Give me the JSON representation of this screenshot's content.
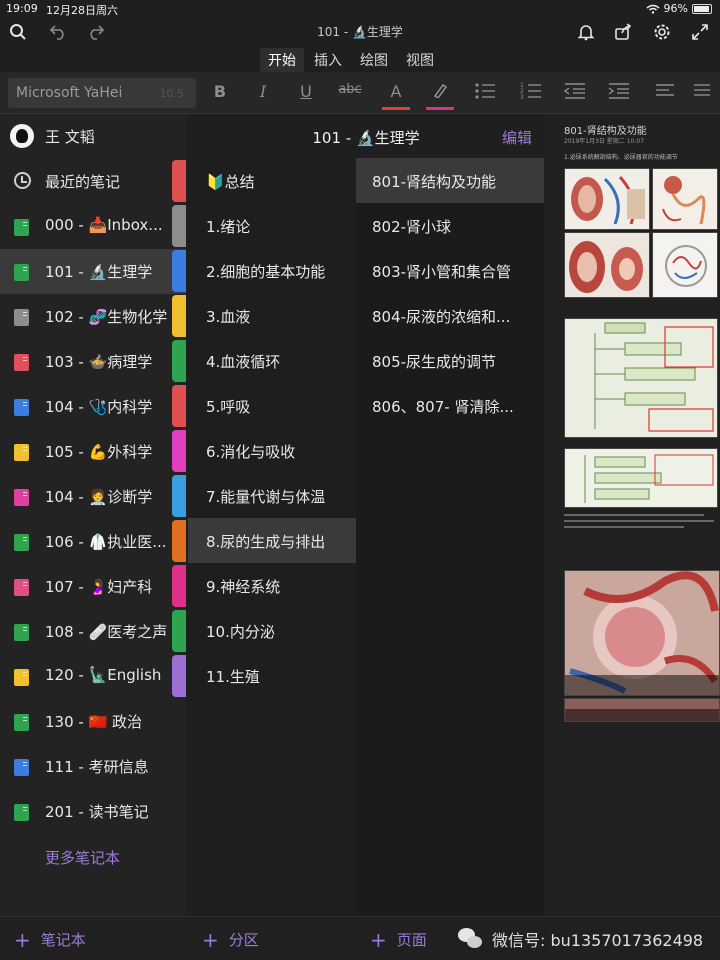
{
  "status": {
    "time": "19:09",
    "date": "12月28日周六",
    "battery": "96%"
  },
  "topbar": {
    "doc_title": "101 - 🔬生理学"
  },
  "ribbon": {
    "tabs": [
      "开始",
      "插入",
      "绘图",
      "视图"
    ],
    "active": "开始"
  },
  "format": {
    "font_name": "Microsoft YaHei",
    "font_size": "10.5",
    "bold": "B",
    "italic": "I",
    "underline": "U",
    "strike": "abc",
    "font_color": "A",
    "font_color_hex": "#e0403a",
    "highlight_hex": "#d2368f"
  },
  "user": {
    "name": "王 文韬"
  },
  "notebooks": {
    "recent": "最近的笔记",
    "items": [
      {
        "label": "000 - 📥Inbox...",
        "color": "#2ea44f"
      },
      {
        "label": "101 - 🔬生理学",
        "color": "#2ea44f"
      },
      {
        "label": "102 - 🧬生物化学",
        "color": "#8d8d8d"
      },
      {
        "label": "103 - 🍲病理学",
        "color": "#e0505c"
      },
      {
        "label": "104 - 🩺内科学",
        "color": "#3b7de0"
      },
      {
        "label": "105 - 💪外科学",
        "color": "#f0c030"
      },
      {
        "label": "104 - 🧑‍⚕️诊断学",
        "color": "#e040a0"
      },
      {
        "label": "106 - 🥼执业医...",
        "color": "#2ea44f"
      },
      {
        "label": "107 - 🤰妇产科",
        "color": "#e04e86"
      },
      {
        "label": "108 - 🩹医考之声",
        "color": "#2ea44f"
      },
      {
        "label": "120 - 🗽English",
        "color": "#f0c030"
      },
      {
        "label": "130 - 🇨🇳 政治",
        "color": "#2ea44f"
      },
      {
        "label": "111 - 考研信息",
        "color": "#3b7de0"
      },
      {
        "label": "201 - 读书笔记",
        "color": "#2ea44f"
      }
    ],
    "more": "更多笔记本"
  },
  "notebook_header": {
    "title": "101 - 🔬生理学",
    "edit": "编辑"
  },
  "sections": [
    {
      "label": "🔰总结",
      "color": "#e05050"
    },
    {
      "label": "1.绪论",
      "color": "#8d8d8d"
    },
    {
      "label": "2.细胞的基本功能",
      "color": "#3b7de0"
    },
    {
      "label": "3.血液",
      "color": "#f0c030"
    },
    {
      "label": "4.血液循环",
      "color": "#2ea44f"
    },
    {
      "label": "5.呼吸",
      "color": "#e05050"
    },
    {
      "label": "6.消化与吸收",
      "color": "#e040c0"
    },
    {
      "label": "7.能量代谢与体温",
      "color": "#3b9de0"
    },
    {
      "label": "8.尿的生成与排出",
      "color": "#e07020"
    },
    {
      "label": "9.神经系统",
      "color": "#e0308a"
    },
    {
      "label": "10.内分泌",
      "color": "#2ea44f"
    },
    {
      "label": "11.生殖",
      "color": "#9b6fd6"
    }
  ],
  "pages": [
    "801-肾结构及功能",
    "802-肾小球",
    "803-肾小管和集合管",
    "804-尿液的浓缩和...",
    "805-尿生成的调节",
    "806、807- 肾清除..."
  ],
  "preview": {
    "title": "801-肾结构及功能",
    "meta": "2019年1月3日 星期二    10:07",
    "text": "1.泌尿系统解剖结构、泌尿器官的功能调节"
  },
  "bottom": {
    "add_notebook": "笔记本",
    "add_section": "分区",
    "add_page": "页面",
    "watermark": "微信号: bu1357017362498"
  }
}
